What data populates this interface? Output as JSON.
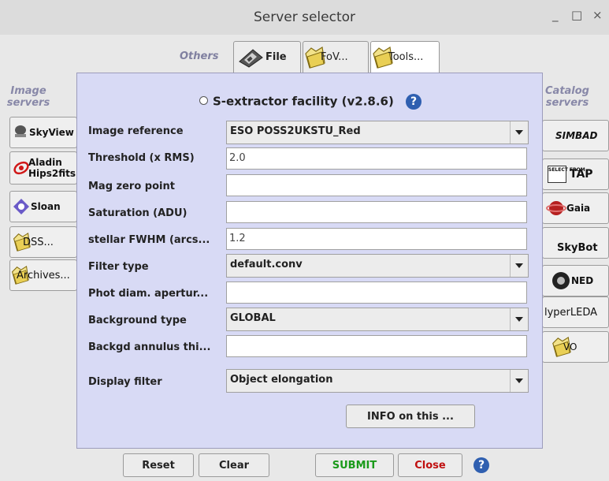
{
  "window": {
    "title": "Server selector",
    "minimize": "_",
    "maximize": "□",
    "close": "×"
  },
  "tabs": {
    "others_label": "Others",
    "items": [
      {
        "label": "File",
        "icon": "floppy-icon"
      },
      {
        "label": "FoV...",
        "icon": "folder-icon"
      },
      {
        "label": "Tools...",
        "icon": "folder-icon"
      }
    ]
  },
  "image_servers": {
    "title": "Image servers",
    "items": [
      {
        "label": "SkyView",
        "icon": "telescope-icon"
      },
      {
        "label": "Aladin Hips2fits",
        "line1": "Aladin",
        "line2": "Hips2fits",
        "icon": "aladin-icon"
      },
      {
        "label": "Sloan",
        "icon": "sloan-icon"
      },
      {
        "label": "DSS...",
        "icon": "folder-icon"
      },
      {
        "label": "Archives...",
        "icon": "folder-icon"
      }
    ]
  },
  "catalog_servers": {
    "title": "Catalog servers",
    "items": [
      {
        "label": "SIMBAD",
        "icon": "simbad-logo"
      },
      {
        "label": "TAP",
        "icon": "select-from-icon",
        "icon_text": "SELECT FROM"
      },
      {
        "label": "Gaia",
        "icon": "gaia-icon"
      },
      {
        "label": "SkyBot",
        "icon": "skybot-logo"
      },
      {
        "label": "NED",
        "icon": "ned-icon"
      },
      {
        "label": "HyperLEDA",
        "shown": "lyperLEDA"
      },
      {
        "label": "VO",
        "icon": "folder-icon"
      }
    ]
  },
  "panel": {
    "header": "S-extractor facility (v2.8.6)",
    "help": "?",
    "fields": [
      {
        "label": "Image reference",
        "kind": "select",
        "value": "ESO POSS2UKSTU_Red"
      },
      {
        "label": "Threshold (x RMS)",
        "kind": "input",
        "value": "2.0"
      },
      {
        "label": "Mag zero point",
        "kind": "input",
        "value": ""
      },
      {
        "label": "Saturation (ADU)",
        "kind": "input",
        "value": ""
      },
      {
        "label": "stellar FWHM (arcs...",
        "kind": "input",
        "value": "1.2"
      },
      {
        "label": "Filter type",
        "kind": "select",
        "value": "default.conv"
      },
      {
        "label": "Phot diam. apertur...",
        "kind": "input",
        "value": ""
      },
      {
        "label": "Background type",
        "kind": "select",
        "value": "GLOBAL"
      },
      {
        "label": "Backgd annulus thi...",
        "kind": "input",
        "value": ""
      },
      {
        "label": "Display filter",
        "kind": "select",
        "value": "Object elongation"
      }
    ],
    "info_button": "INFO on this ..."
  },
  "footer": {
    "reset": "Reset",
    "clear": "Clear",
    "submit": "SUBMIT",
    "close": "Close",
    "help": "?"
  },
  "colors": {
    "submit_text": "#1a9a1a",
    "close_text": "#c01010",
    "accent": "#2f5fb0",
    "panel_bg": "#d8daf5"
  }
}
